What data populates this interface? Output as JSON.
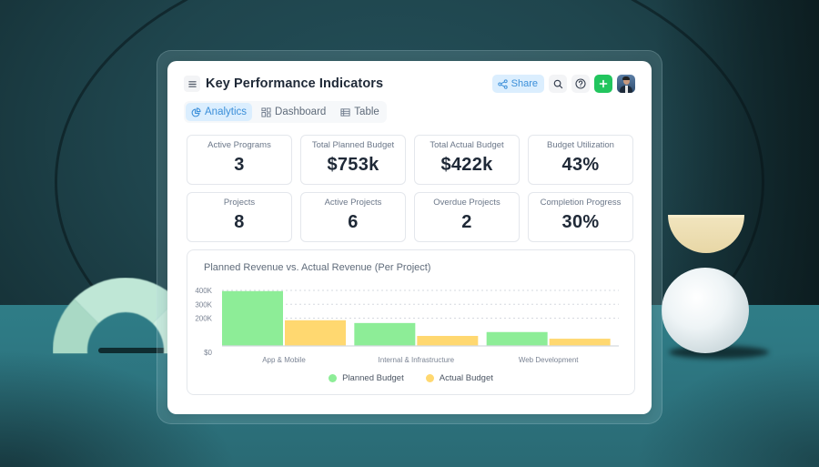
{
  "header": {
    "title": "Key Performance Indicators",
    "share_label": "Share"
  },
  "icons": {
    "menu": "menu-icon",
    "share": "share-icon",
    "search": "search-icon",
    "help": "help-circle-icon",
    "add": "plus-icon",
    "avatar": "user-avatar"
  },
  "tabs": [
    {
      "label": "Analytics",
      "icon": "pie-chart-icon",
      "active": true
    },
    {
      "label": "Dashboard",
      "icon": "grid-icon",
      "active": false
    },
    {
      "label": "Table",
      "icon": "table-icon",
      "active": false
    }
  ],
  "kpis": [
    {
      "label": "Active Programs",
      "value": "3"
    },
    {
      "label": "Total Planned Budget",
      "value": "$753k"
    },
    {
      "label": "Total Actual Budget",
      "value": "$422k"
    },
    {
      "label": "Budget Utilization",
      "value": "43%"
    },
    {
      "label": "Projects",
      "value": "8"
    },
    {
      "label": "Active Projects",
      "value": "6"
    },
    {
      "label": "Overdue Projects",
      "value": "2"
    },
    {
      "label": "Completion Progress",
      "value": "30%"
    }
  ],
  "colors": {
    "accent": "#3b8fd9",
    "add_button": "#22c55e",
    "planned": "#8ded97",
    "actual": "#ffd870"
  },
  "chart_data": {
    "type": "bar",
    "title": "Planned Revenue vs. Actual Revenue (Per Project)",
    "categories": [
      "App & Mobile",
      "Internal & Infrastructure",
      "Web Development"
    ],
    "series": [
      {
        "name": "Planned Budget",
        "values": [
          395000,
          165000,
          100000
        ]
      },
      {
        "name": "Actual Budget",
        "values": [
          185000,
          72000,
          52000
        ]
      }
    ],
    "y_ticks": [
      {
        "value": 0,
        "label": "$0"
      },
      {
        "value": 200000,
        "label": "200K"
      },
      {
        "value": 300000,
        "label": "300K"
      },
      {
        "value": 400000,
        "label": "400K"
      }
    ],
    "xlabel": "",
    "ylabel": "",
    "ylim": [
      0,
      400000
    ],
    "grid": true,
    "legend": "bottom-center"
  }
}
